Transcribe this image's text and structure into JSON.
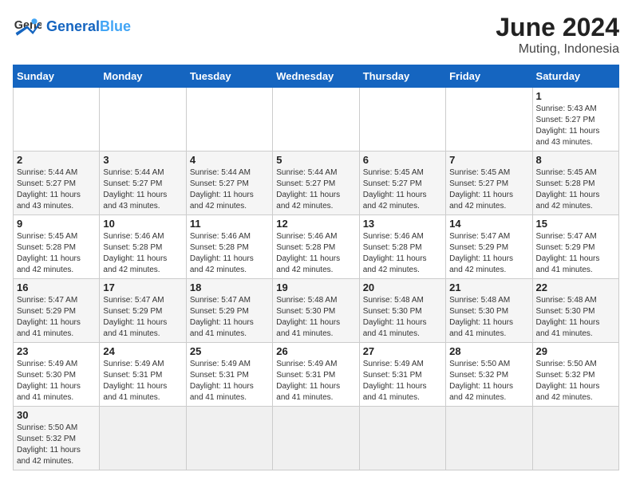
{
  "header": {
    "logo_general": "General",
    "logo_blue": "Blue",
    "month_year": "June 2024",
    "location": "Muting, Indonesia"
  },
  "weekdays": [
    "Sunday",
    "Monday",
    "Tuesday",
    "Wednesday",
    "Thursday",
    "Friday",
    "Saturday"
  ],
  "weeks": [
    [
      {
        "day": "",
        "info": ""
      },
      {
        "day": "",
        "info": ""
      },
      {
        "day": "",
        "info": ""
      },
      {
        "day": "",
        "info": ""
      },
      {
        "day": "",
        "info": ""
      },
      {
        "day": "",
        "info": ""
      },
      {
        "day": "1",
        "info": "Sunrise: 5:43 AM\nSunset: 5:27 PM\nDaylight: 11 hours\nand 43 minutes."
      }
    ],
    [
      {
        "day": "2",
        "info": "Sunrise: 5:44 AM\nSunset: 5:27 PM\nDaylight: 11 hours\nand 43 minutes."
      },
      {
        "day": "3",
        "info": "Sunrise: 5:44 AM\nSunset: 5:27 PM\nDaylight: 11 hours\nand 43 minutes."
      },
      {
        "day": "4",
        "info": "Sunrise: 5:44 AM\nSunset: 5:27 PM\nDaylight: 11 hours\nand 42 minutes."
      },
      {
        "day": "5",
        "info": "Sunrise: 5:44 AM\nSunset: 5:27 PM\nDaylight: 11 hours\nand 42 minutes."
      },
      {
        "day": "6",
        "info": "Sunrise: 5:45 AM\nSunset: 5:27 PM\nDaylight: 11 hours\nand 42 minutes."
      },
      {
        "day": "7",
        "info": "Sunrise: 5:45 AM\nSunset: 5:27 PM\nDaylight: 11 hours\nand 42 minutes."
      },
      {
        "day": "8",
        "info": "Sunrise: 5:45 AM\nSunset: 5:28 PM\nDaylight: 11 hours\nand 42 minutes."
      }
    ],
    [
      {
        "day": "9",
        "info": "Sunrise: 5:45 AM\nSunset: 5:28 PM\nDaylight: 11 hours\nand 42 minutes."
      },
      {
        "day": "10",
        "info": "Sunrise: 5:46 AM\nSunset: 5:28 PM\nDaylight: 11 hours\nand 42 minutes."
      },
      {
        "day": "11",
        "info": "Sunrise: 5:46 AM\nSunset: 5:28 PM\nDaylight: 11 hours\nand 42 minutes."
      },
      {
        "day": "12",
        "info": "Sunrise: 5:46 AM\nSunset: 5:28 PM\nDaylight: 11 hours\nand 42 minutes."
      },
      {
        "day": "13",
        "info": "Sunrise: 5:46 AM\nSunset: 5:28 PM\nDaylight: 11 hours\nand 42 minutes."
      },
      {
        "day": "14",
        "info": "Sunrise: 5:47 AM\nSunset: 5:29 PM\nDaylight: 11 hours\nand 42 minutes."
      },
      {
        "day": "15",
        "info": "Sunrise: 5:47 AM\nSunset: 5:29 PM\nDaylight: 11 hours\nand 41 minutes."
      }
    ],
    [
      {
        "day": "16",
        "info": "Sunrise: 5:47 AM\nSunset: 5:29 PM\nDaylight: 11 hours\nand 41 minutes."
      },
      {
        "day": "17",
        "info": "Sunrise: 5:47 AM\nSunset: 5:29 PM\nDaylight: 11 hours\nand 41 minutes."
      },
      {
        "day": "18",
        "info": "Sunrise: 5:47 AM\nSunset: 5:29 PM\nDaylight: 11 hours\nand 41 minutes."
      },
      {
        "day": "19",
        "info": "Sunrise: 5:48 AM\nSunset: 5:30 PM\nDaylight: 11 hours\nand 41 minutes."
      },
      {
        "day": "20",
        "info": "Sunrise: 5:48 AM\nSunset: 5:30 PM\nDaylight: 11 hours\nand 41 minutes."
      },
      {
        "day": "21",
        "info": "Sunrise: 5:48 AM\nSunset: 5:30 PM\nDaylight: 11 hours\nand 41 minutes."
      },
      {
        "day": "22",
        "info": "Sunrise: 5:48 AM\nSunset: 5:30 PM\nDaylight: 11 hours\nand 41 minutes."
      }
    ],
    [
      {
        "day": "23",
        "info": "Sunrise: 5:49 AM\nSunset: 5:30 PM\nDaylight: 11 hours\nand 41 minutes."
      },
      {
        "day": "24",
        "info": "Sunrise: 5:49 AM\nSunset: 5:31 PM\nDaylight: 11 hours\nand 41 minutes."
      },
      {
        "day": "25",
        "info": "Sunrise: 5:49 AM\nSunset: 5:31 PM\nDaylight: 11 hours\nand 41 minutes."
      },
      {
        "day": "26",
        "info": "Sunrise: 5:49 AM\nSunset: 5:31 PM\nDaylight: 11 hours\nand 41 minutes."
      },
      {
        "day": "27",
        "info": "Sunrise: 5:49 AM\nSunset: 5:31 PM\nDaylight: 11 hours\nand 41 minutes."
      },
      {
        "day": "28",
        "info": "Sunrise: 5:50 AM\nSunset: 5:32 PM\nDaylight: 11 hours\nand 42 minutes."
      },
      {
        "day": "29",
        "info": "Sunrise: 5:50 AM\nSunset: 5:32 PM\nDaylight: 11 hours\nand 42 minutes."
      }
    ],
    [
      {
        "day": "30",
        "info": "Sunrise: 5:50 AM\nSunset: 5:32 PM\nDaylight: 11 hours\nand 42 minutes."
      },
      {
        "day": "",
        "info": ""
      },
      {
        "day": "",
        "info": ""
      },
      {
        "day": "",
        "info": ""
      },
      {
        "day": "",
        "info": ""
      },
      {
        "day": "",
        "info": ""
      },
      {
        "day": "",
        "info": ""
      }
    ]
  ]
}
